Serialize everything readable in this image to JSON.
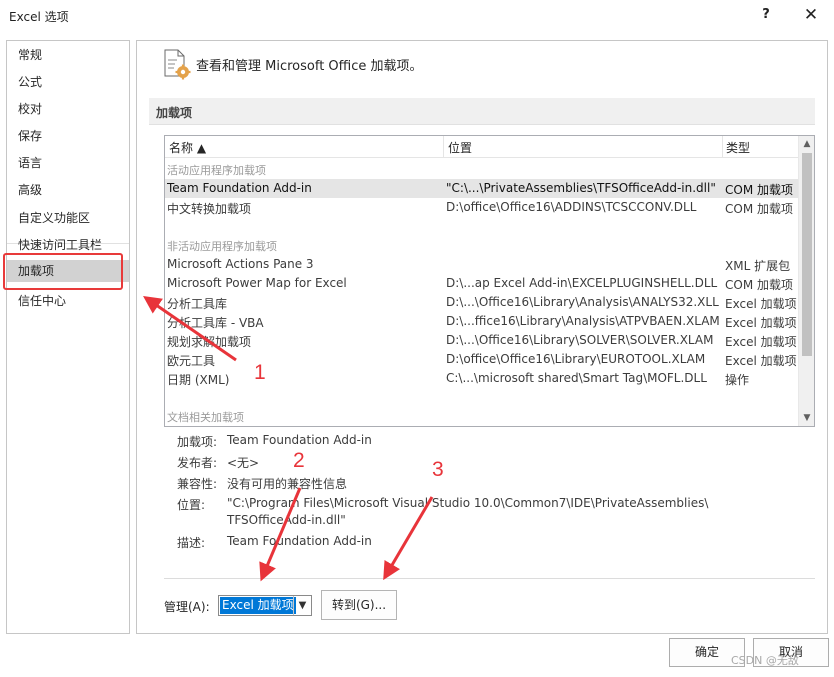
{
  "window": {
    "title": "Excel 选项",
    "help_glyph": "?",
    "close_glyph": "✕"
  },
  "sidebar": {
    "items": [
      {
        "label": "常规"
      },
      {
        "label": "公式"
      },
      {
        "label": "校对"
      },
      {
        "label": "保存"
      },
      {
        "label": "语言"
      },
      {
        "label": "高级"
      },
      {
        "label": "自定义功能区"
      },
      {
        "label": "快速访问工具栏"
      },
      {
        "label": "加载项"
      },
      {
        "label": "信任中心"
      }
    ],
    "selected_label": "加载项"
  },
  "main": {
    "header_text": "查看和管理 Microsoft Office 加载项。",
    "section_title": "加载项"
  },
  "addins_table": {
    "columns": [
      "名称 ▲",
      "位置",
      "类型"
    ],
    "groups": {
      "active": "活动应用程序加载项",
      "inactive": "非活动应用程序加载项",
      "document": "文档相关加载项"
    },
    "active_rows": [
      {
        "name": "Team Foundation Add-in",
        "location": "\"C:\\...\\PrivateAssemblies\\TFSOfficeAdd-in.dll\"",
        "type": "COM 加载项"
      },
      {
        "name": "中文转换加载项",
        "location": "D:\\office\\Office16\\ADDINS\\TCSCCONV.DLL",
        "type": "COM 加载项"
      }
    ],
    "inactive_rows": [
      {
        "name": "Microsoft Actions Pane 3",
        "location": "",
        "type": "XML 扩展包"
      },
      {
        "name": "Microsoft Power Map for Excel",
        "location": "D:\\...ap Excel Add-in\\EXCELPLUGINSHELL.DLL",
        "type": "COM 加载项"
      },
      {
        "name": "分析工具库",
        "location": "D:\\...\\Office16\\Library\\Analysis\\ANALYS32.XLL",
        "type": "Excel 加载项"
      },
      {
        "name": "分析工具库 - VBA",
        "location": "D:\\...ffice16\\Library\\Analysis\\ATPVBAEN.XLAM",
        "type": "Excel 加载项"
      },
      {
        "name": "规划求解加载项",
        "location": "D:\\...\\Office16\\Library\\SOLVER\\SOLVER.XLAM",
        "type": "Excel 加载项"
      },
      {
        "name": "欧元工具",
        "location": "D:\\office\\Office16\\Library\\EUROTOOL.XLAM",
        "type": "Excel 加载项"
      },
      {
        "name": "日期 (XML)",
        "location": "C:\\...\\microsoft shared\\Smart Tag\\MOFL.DLL",
        "type": "操作"
      }
    ]
  },
  "details": {
    "addin_label": "加载项:",
    "addin_value": "Team Foundation Add-in",
    "publisher_label": "发布者:",
    "publisher_value": "<无>",
    "compat_label": "兼容性:",
    "compat_value": "没有可用的兼容性信息",
    "location_label": "位置:",
    "location_value_line1": "\"C:\\Program Files\\Microsoft Visual Studio 10.0\\Common7\\IDE\\PrivateAssemblies\\",
    "location_value_line2": "TFSOfficeAdd-in.dll\"",
    "desc_label": "描述:",
    "desc_value": "Team Foundation Add-in"
  },
  "manage": {
    "label": "管理(A):",
    "selected_value": "Excel 加载项",
    "go_button": "转到(G)..."
  },
  "footer": {
    "ok": "确定",
    "cancel": "取消"
  },
  "annotations": {
    "numbers": [
      "1",
      "2",
      "3"
    ],
    "color": "#e8343a"
  },
  "watermark": "CSDN @无敌"
}
